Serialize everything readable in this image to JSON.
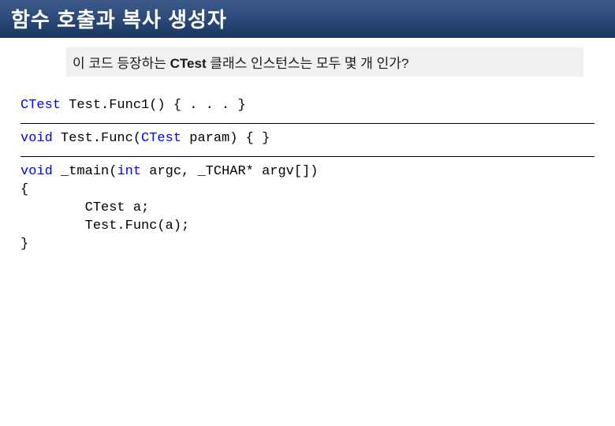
{
  "header": {
    "title": "함수 호출과 복사 생성자"
  },
  "subhead": {
    "pre": "이 코드 등장하는 ",
    "emph": "CTest",
    "post": " 클래스 인스턴스는 모두 몇 개 인가?"
  },
  "code": {
    "line1_a": "CTest",
    "line1_b": " Test.Func1() { . . . }",
    "line2_a": "void",
    "line2_b": " Test.Func(",
    "line2_c": "CTest",
    "line2_d": " param) { }",
    "line3_a": "void",
    "line3_b": " _tmain(",
    "line3_c": "int",
    "line3_d": " argc, _TCHAR* argv[])",
    "line4": "{",
    "line5": "        CTest a;",
    "line6": "        Test.Func(a);",
    "line7": "}"
  }
}
